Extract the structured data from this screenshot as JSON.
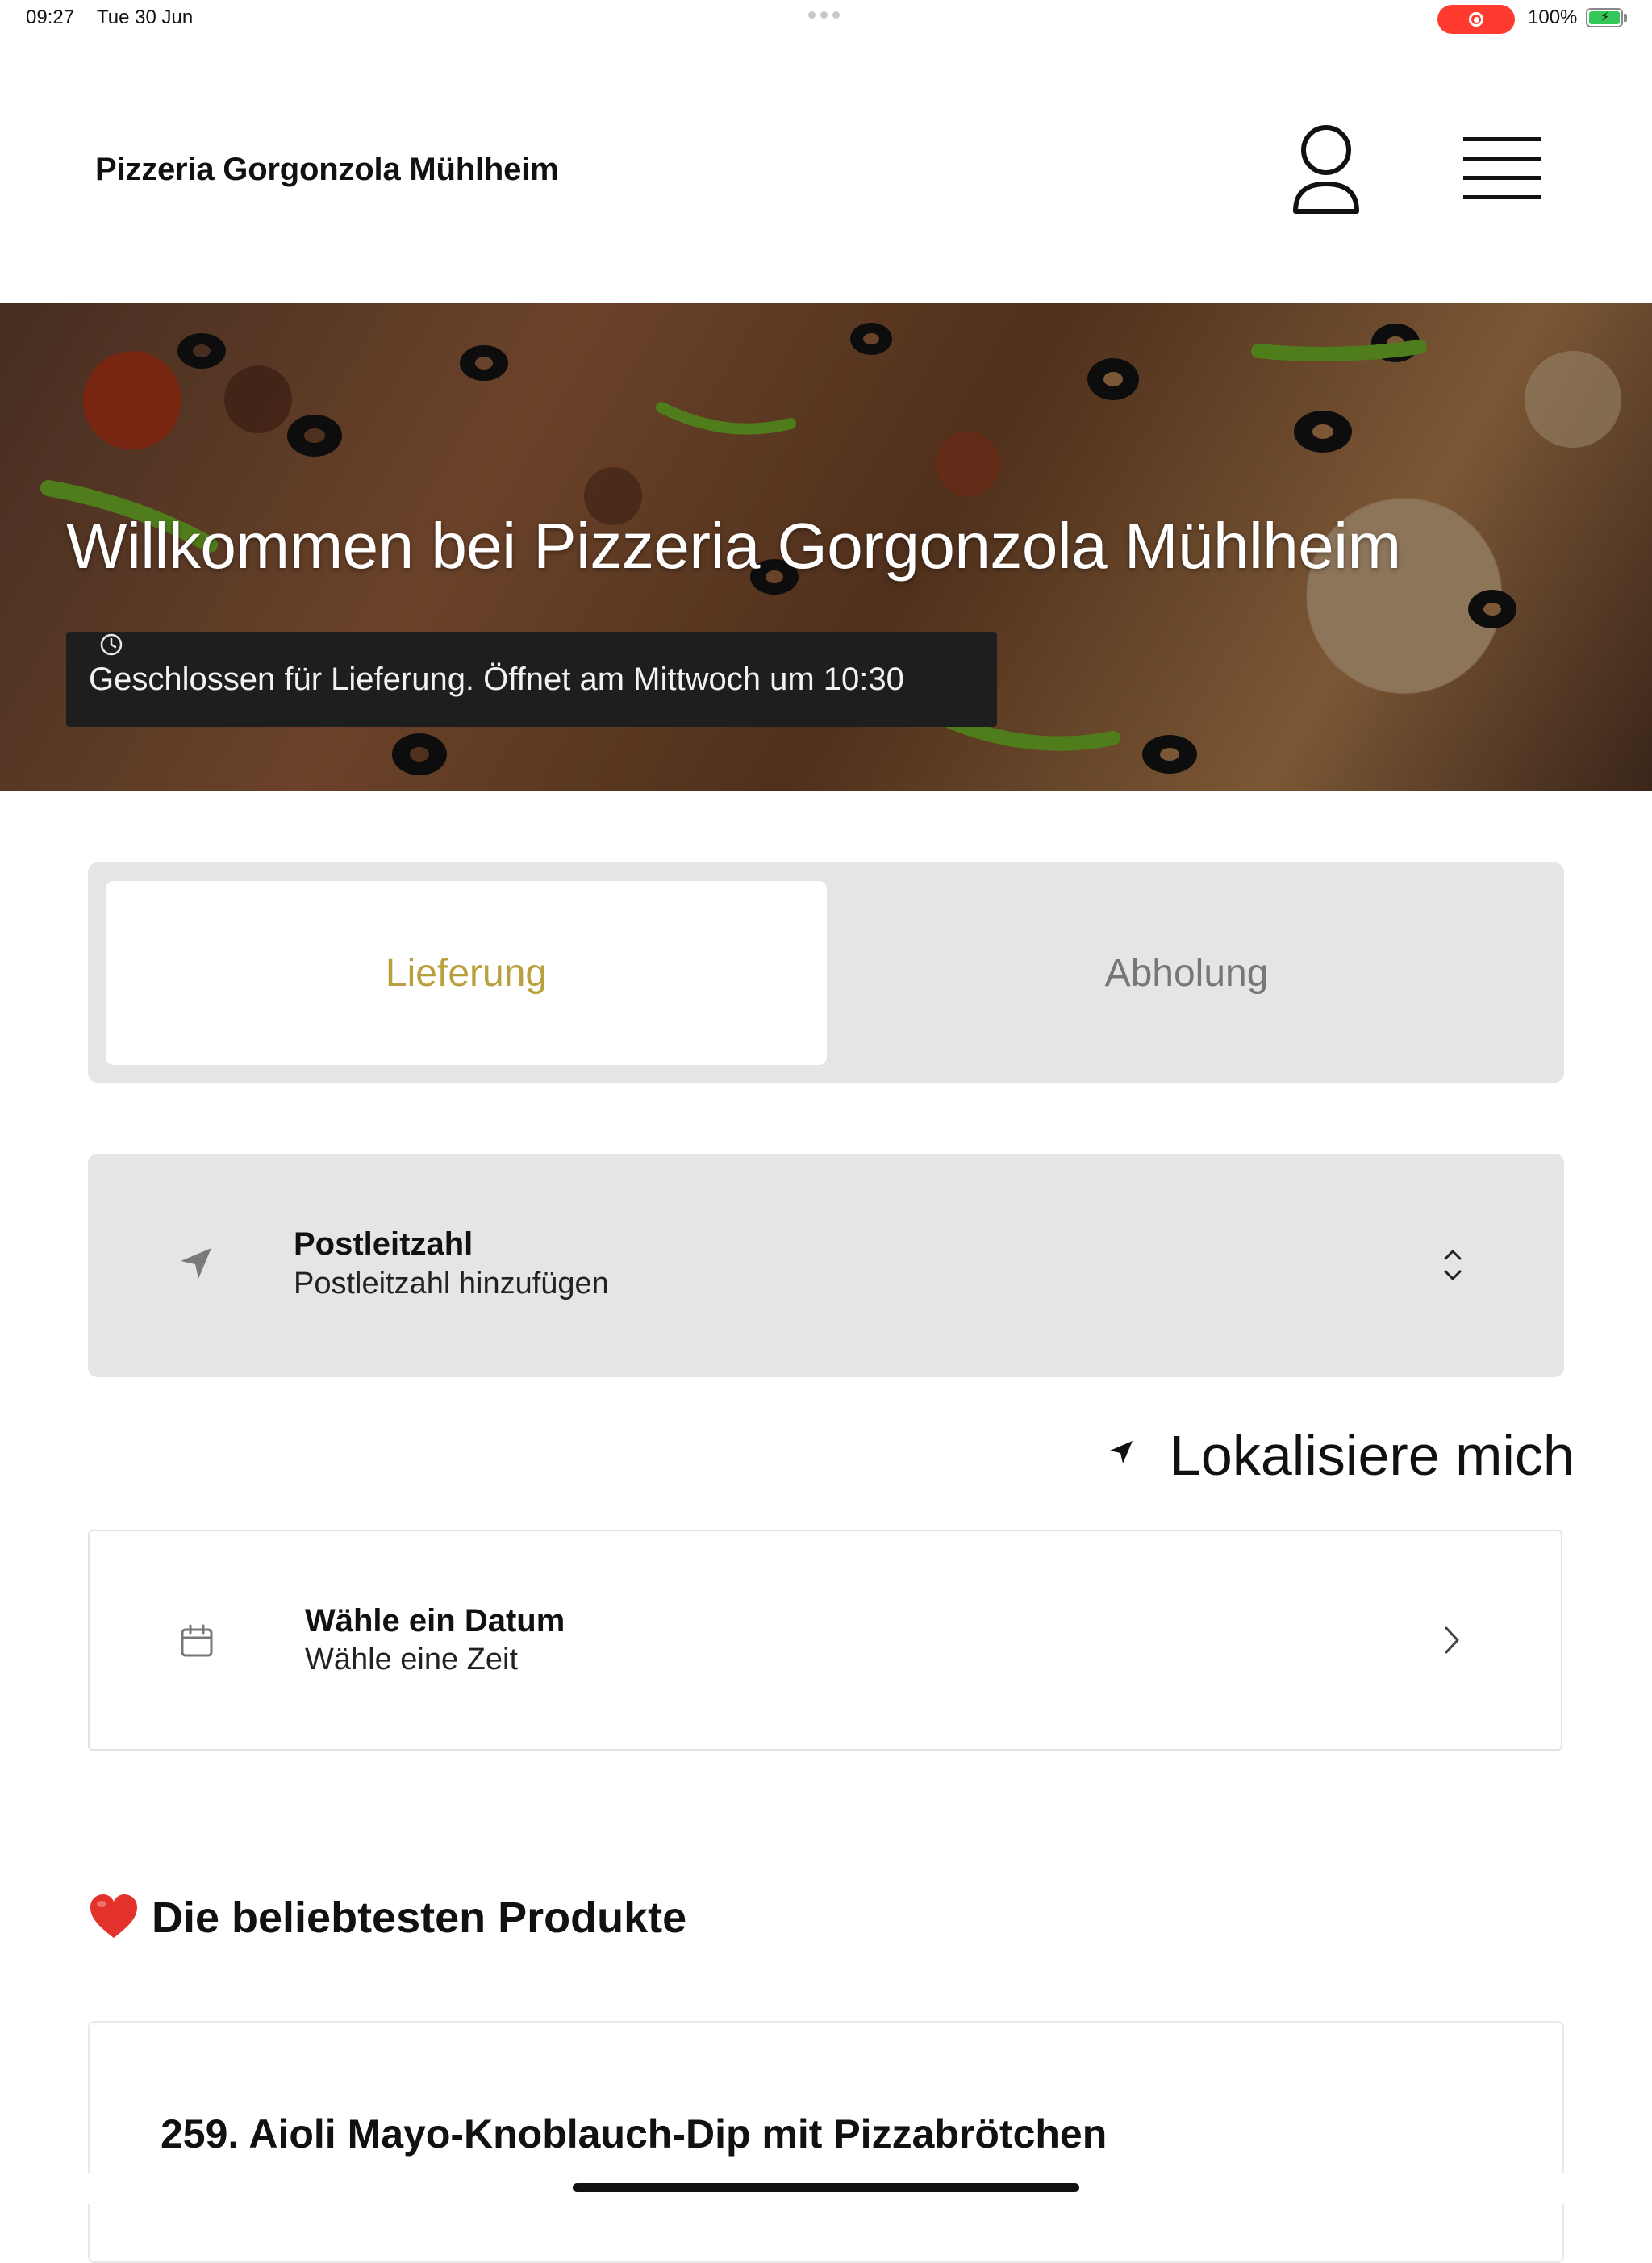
{
  "status_bar": {
    "time": "09:27",
    "date": "Tue 30 Jun",
    "battery_percent": "100%",
    "battery_level": 1.0,
    "recording_color": "#ff3b30"
  },
  "header": {
    "brand": "Pizzeria Gorgonzola Mühlheim",
    "user_icon": "user-icon",
    "menu_icon": "hamburger-menu-icon"
  },
  "hero": {
    "title": "Willkommen bei Pizzeria Gorgonzola Mühlheim",
    "status_text": "Geschlossen für Lieferung. Öffnet am Mittwoch um 10:30",
    "status_icon": "clock-icon"
  },
  "order_mode": {
    "delivery_label": "Lieferung",
    "pickup_label": "Abholung",
    "selected": "Lieferung",
    "accent_color": "#b8a03c"
  },
  "postcode": {
    "label": "Postleitzahl",
    "placeholder": "Postleitzahl hinzufügen",
    "icon": "location-arrow-icon"
  },
  "locate": {
    "label": "Lokalisiere mich",
    "icon": "location-arrow-icon"
  },
  "schedule": {
    "date_label": "Wähle ein Datum",
    "time_label": "Wähle eine Zeit",
    "icon": "calendar-icon"
  },
  "popular": {
    "title": "Die beliebtesten Produkte",
    "icon": "heart-icon",
    "items": [
      {
        "name": "259. Aioli  Mayo-Knoblauch-Dip mit Pizzabrötchen"
      }
    ]
  }
}
